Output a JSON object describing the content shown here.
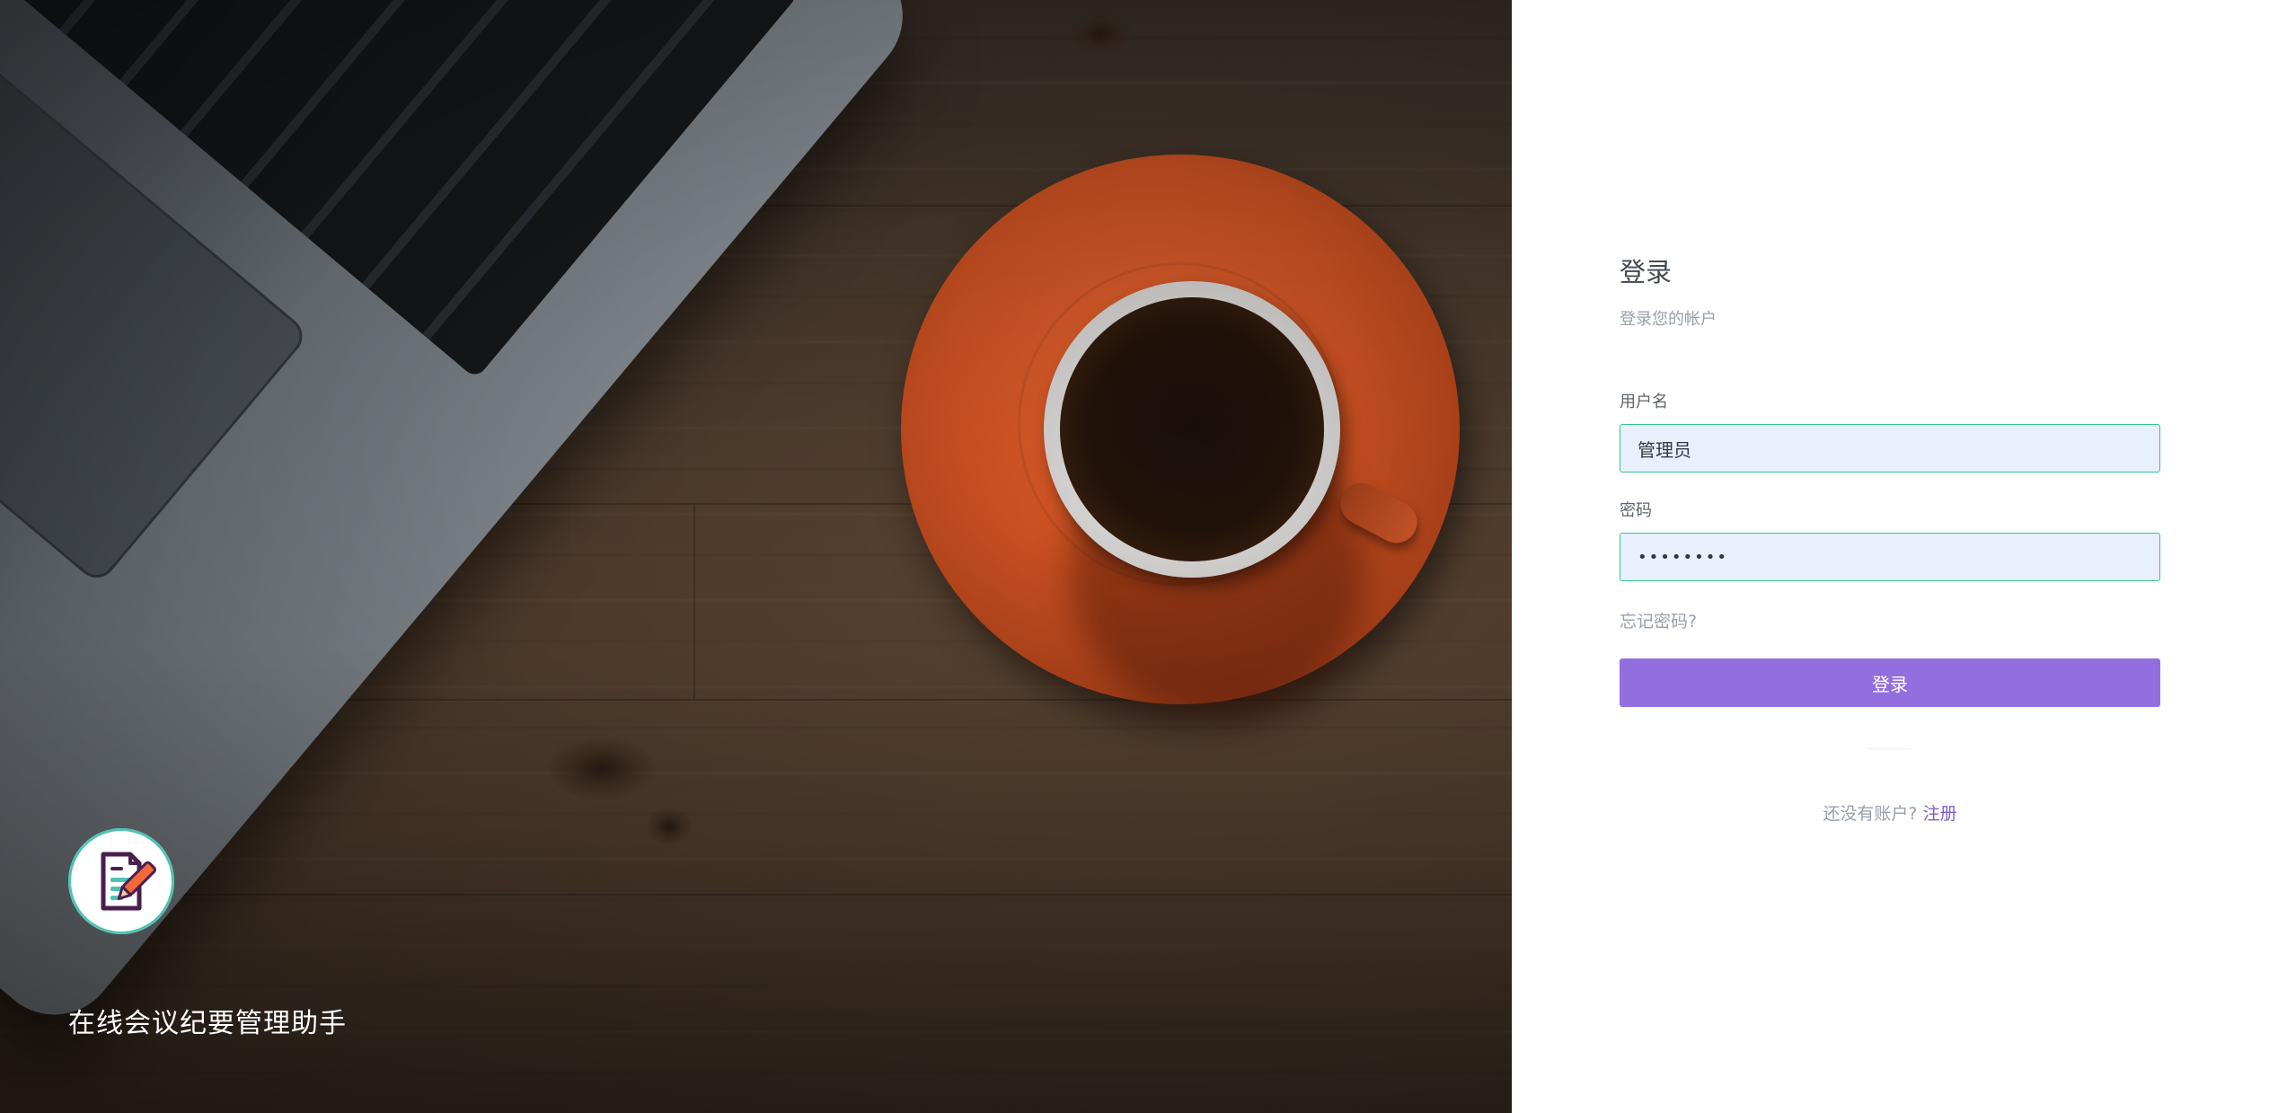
{
  "brand": {
    "title": "在线会议纪要管理助手",
    "logo_icon": "document-pencil-icon"
  },
  "login": {
    "title": "登录",
    "subtitle": "登录您的帐户",
    "username_label": "用户名",
    "username_value": "管理员",
    "password_label": "密码",
    "password_value": "12345678",
    "forgot_password": "忘记密码?",
    "submit_label": "登录",
    "no_account_text": "还没有账户?",
    "register_link": "注册"
  },
  "colors": {
    "accent": "#936ede",
    "link": "#7e5fcf",
    "input_border": "#35c48c",
    "input_bg": "#e8f0fe",
    "logo_ring": "#4fc3b3"
  }
}
